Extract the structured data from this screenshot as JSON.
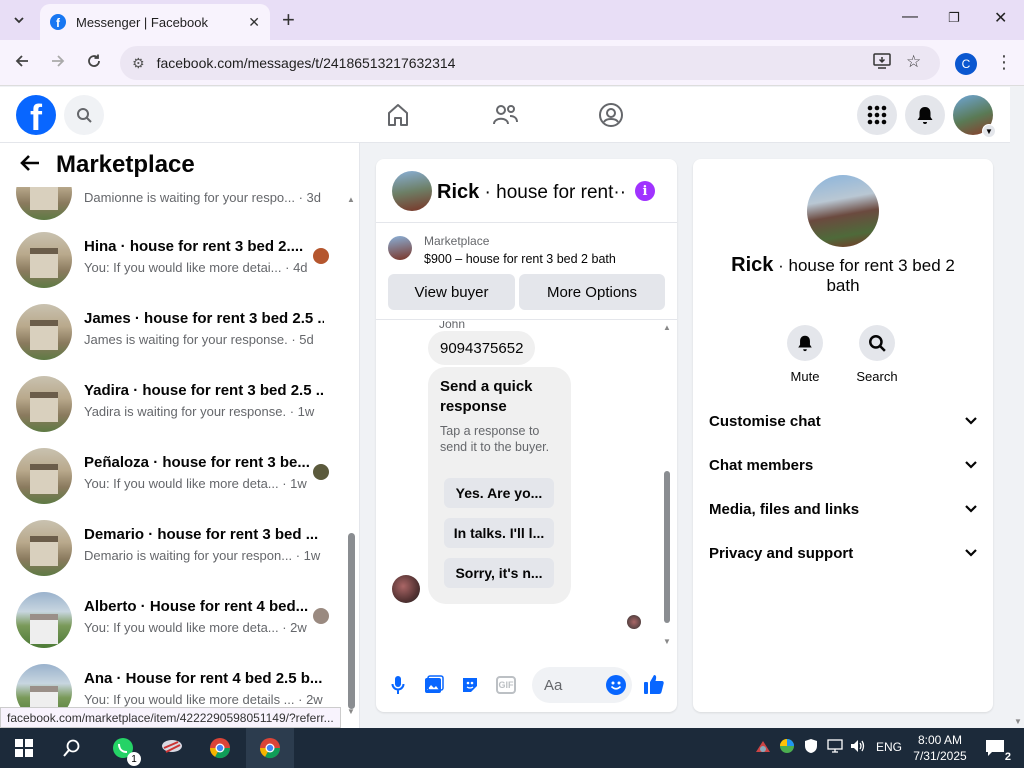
{
  "browser": {
    "tab_title": "Messenger | Facebook",
    "url": "facebook.com/messages/t/24186513217632314",
    "profile_initial": "C",
    "status_url": "facebook.com/marketplace/item/4222290598051149/?referr..."
  },
  "left": {
    "title": "Marketplace",
    "conversations": [
      {
        "name": "",
        "snippet": "Damionne is waiting for your respo... · 3d",
        "thumb": "house"
      },
      {
        "name": "Hina · house for rent 3 bed 2....",
        "snippet": "You: If you would like more detai... · 4d",
        "thumb": "house"
      },
      {
        "name": "James · house for rent 3 bed 2.5 ...",
        "snippet": "James is waiting for your response. · 5d",
        "thumb": "house"
      },
      {
        "name": "Yadira · house for rent 3 bed 2.5 ...",
        "snippet": "Yadira is waiting for your response. · 1w",
        "thumb": "house"
      },
      {
        "name": "Peñaloza · house for rent 3 be...",
        "snippet": "You: If you would like more deta... · 1w",
        "thumb": "house"
      },
      {
        "name": "Demario · house for rent 3 bed ...",
        "snippet": "Demario is waiting for your respon... · 1w",
        "thumb": "house"
      },
      {
        "name": "Alberto · House for rent 4 bed...",
        "snippet": "You: If you would like more deta... · 2w",
        "thumb": "green"
      },
      {
        "name": "Ana · House for rent 4 bed 2.5 b...",
        "snippet": "You: If you would like more details ... · 2w",
        "thumb": "green"
      }
    ]
  },
  "chat": {
    "name": "Rick",
    "subject": " · house for rent···",
    "marketplace_label": "Marketplace",
    "listing": "$900 – house for rent 3 bed 2 bath",
    "view_buyer": "View buyer",
    "more_options": "More Options",
    "sender_label": "John",
    "phone_message": "9094375652",
    "quick_title": "Send a quick response",
    "quick_sub": "Tap a response to send it to the buyer.",
    "quick_options": [
      "Yes. Are yo...",
      "In talks. I'll l...",
      "Sorry, it's n..."
    ],
    "composer_placeholder": "Aa",
    "gif_label": "GIF"
  },
  "info": {
    "name": "Rick",
    "subject": " · house for rent 3 bed 2 bath",
    "actions": [
      {
        "label": "Mute",
        "icon": "bell-icon"
      },
      {
        "label": "Search",
        "icon": "search-icon"
      }
    ],
    "sections": [
      "Customise chat",
      "Chat members",
      "Media, files and links",
      "Privacy and support"
    ]
  },
  "taskbar": {
    "time": "8:00 AM",
    "date": "7/31/2025",
    "lang": "ENG",
    "whatsapp_badge": "1",
    "notif_count": "2"
  },
  "colors": {
    "fb_blue": "#0866ff",
    "info_purple": "#a033ff",
    "taskbar": "#1c2a3a"
  }
}
